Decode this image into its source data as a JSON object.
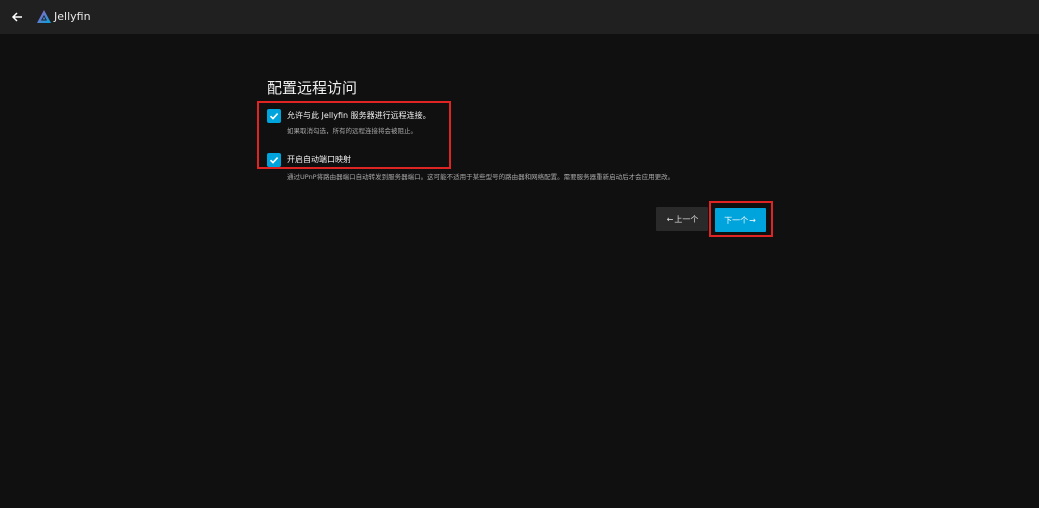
{
  "header": {
    "brand": "Jellyfin",
    "back_icon": "arrow-left-icon",
    "logo_icon": "jellyfin-logo-icon"
  },
  "wizard": {
    "title": "配置远程访问",
    "remote_access": {
      "label": "允许与此 Jellyfin 服务器进行远程连接。",
      "help": "如果取消勾选，所有的远程连接将会被阻止。",
      "checked": true
    },
    "port_mapping": {
      "label": "开启自动端口映射",
      "help": "通过UPnP将路由器端口自动转发到服务器端口。这可能不适用于某些型号的路由器和网络配置。需要服务器重新启动后才会应用更改。",
      "checked": true
    },
    "buttons": {
      "previous_label": "上一个",
      "next_label": "下一个"
    }
  },
  "colors": {
    "accent": "#00a4dc",
    "highlight": "#e02424",
    "background": "#101010",
    "header": "#202020"
  }
}
